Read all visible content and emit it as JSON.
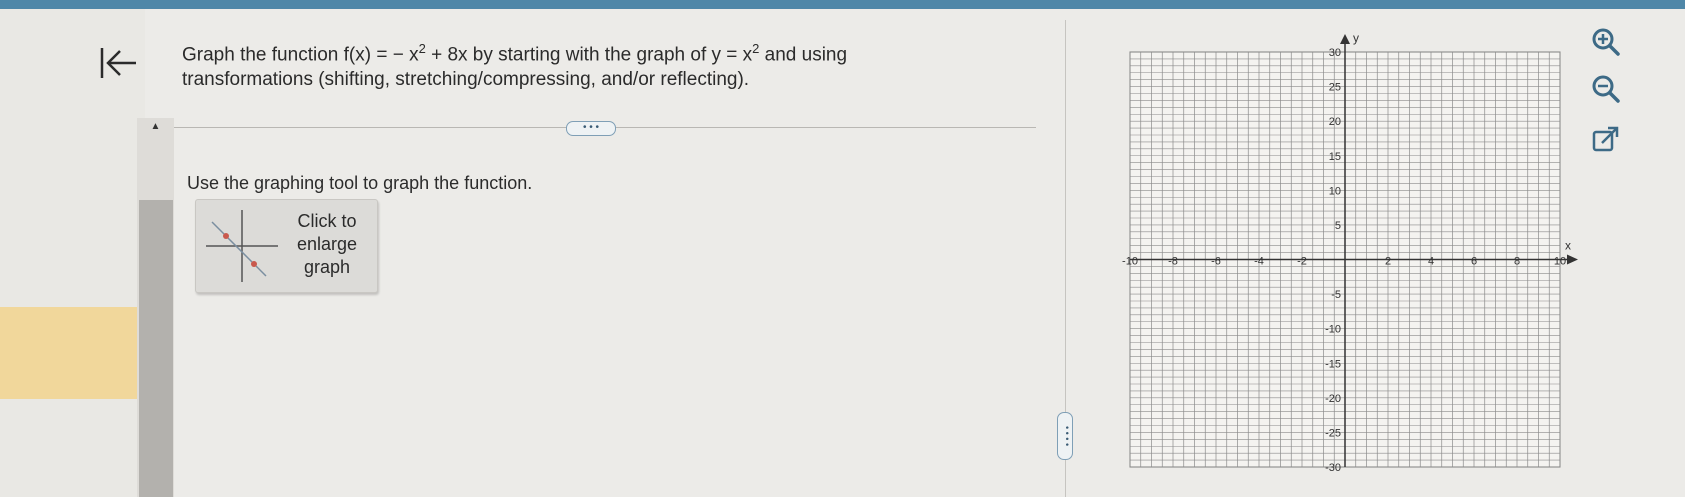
{
  "question": {
    "part1": "Graph the function f(x) = − x",
    "exp1": "2",
    "part2": " + 8x by starting with the graph of y = x",
    "exp2": "2",
    "part3": " and using transformations (shifting, stretching/compressing, and/or reflecting)."
  },
  "more_label": "• • •",
  "splitter_label": "• • • •",
  "instruction": "Use the graphing tool to graph the function.",
  "enlarge": {
    "line1": "Click to",
    "line2": "enlarge",
    "line3": "graph"
  },
  "graph": {
    "x_axis_label": "x",
    "y_axis_label": "y",
    "x_ticks": [
      "-10",
      "-8",
      "-6",
      "-4",
      "-2",
      "2",
      "4",
      "6",
      "8",
      "10"
    ],
    "y_ticks": [
      "30",
      "25",
      "20",
      "15",
      "10",
      "5",
      "-5",
      "-10",
      "-15",
      "-20",
      "-25",
      "-30"
    ],
    "x_range": [
      -10,
      10
    ],
    "y_range": [
      -30,
      30
    ]
  },
  "tools": [
    "zoom-in-icon",
    "zoom-out-icon",
    "open-new-window-icon"
  ],
  "colors": {
    "accent": "#4f87a8",
    "tool": "#3d6a86",
    "grid": "#8a8a8a",
    "highlight": "#f1d79b"
  }
}
